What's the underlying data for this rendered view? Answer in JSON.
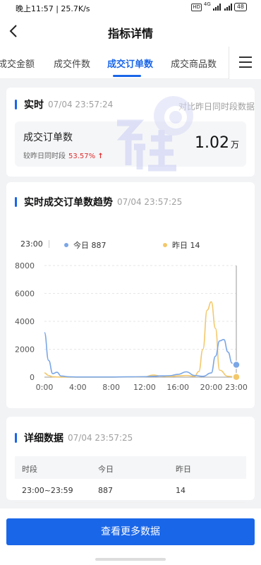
{
  "status_bar": {
    "time": "晚上11:57 | 25.7K/s",
    "hd": "HD",
    "network": "4G",
    "battery": "48"
  },
  "header": {
    "title": "指标详情"
  },
  "tabs": [
    {
      "label": "成交金额"
    },
    {
      "label": "成交件数"
    },
    {
      "label": "成交订单数"
    },
    {
      "label": "成交商品数"
    }
  ],
  "realtime": {
    "title": "实时",
    "timestamp": "07/04 23:57:24",
    "compare_note": "对比昨日同时段数据",
    "metric_name": "成交订单数",
    "compare_label": "较昨日同时段",
    "compare_pct": "53.57%",
    "value": "1.02",
    "unit": "万"
  },
  "trend": {
    "title": "实时成交订单数趋势",
    "timestamp": "07/04 23:57:25",
    "legend_time": "23:00",
    "today_label": "今日",
    "today_value": "887",
    "yesterday_label": "昨日",
    "yesterday_value": "14"
  },
  "chart_data": {
    "type": "line",
    "x_ticks": [
      "0:00",
      "4:00",
      "8:00",
      "12:00",
      "16:00",
      "20:00",
      "23:00"
    ],
    "y_ticks": [
      "8000",
      "6000",
      "4000",
      "2000",
      "0"
    ],
    "ylim": [
      0,
      8000
    ],
    "series": [
      {
        "name": "今日",
        "color": "#7aa6e6",
        "x": [
          0,
          0.5,
          1,
          1.5,
          2,
          3,
          4,
          6,
          8,
          10,
          12,
          13,
          14,
          15,
          16,
          17,
          18,
          19,
          20,
          20.5,
          21,
          21.5,
          22,
          22.5,
          23
        ],
        "values": [
          3200,
          1200,
          250,
          350,
          80,
          20,
          10,
          8,
          10,
          20,
          30,
          60,
          90,
          100,
          200,
          380,
          120,
          60,
          300,
          1500,
          2600,
          2700,
          1800,
          1000,
          887
        ]
      },
      {
        "name": "昨日",
        "color": "#f3c86b",
        "x": [
          0,
          0.5,
          1,
          1.5,
          2,
          4,
          8,
          12,
          13,
          14,
          15,
          16,
          17,
          18,
          18.5,
          19,
          19.5,
          20,
          20.5,
          21,
          22,
          23
        ],
        "values": [
          300,
          120,
          30,
          10,
          5,
          3,
          5,
          20,
          150,
          80,
          40,
          90,
          120,
          60,
          400,
          2000,
          4800,
          5400,
          3500,
          500,
          60,
          14
        ]
      }
    ],
    "grid": true
  },
  "detail": {
    "title": "详细数据",
    "timestamp": "07/04 23:57:25",
    "columns": [
      "时段",
      "今日",
      "昨日"
    ],
    "rows": [
      [
        "23:00~23:59",
        "887",
        "14"
      ]
    ]
  },
  "more_button": {
    "label": "查看更多数据"
  },
  "colors": {
    "accent": "#1a66e8",
    "up": "#e02d2d",
    "today": "#7aa6e6",
    "yesterday": "#f3c86b"
  }
}
